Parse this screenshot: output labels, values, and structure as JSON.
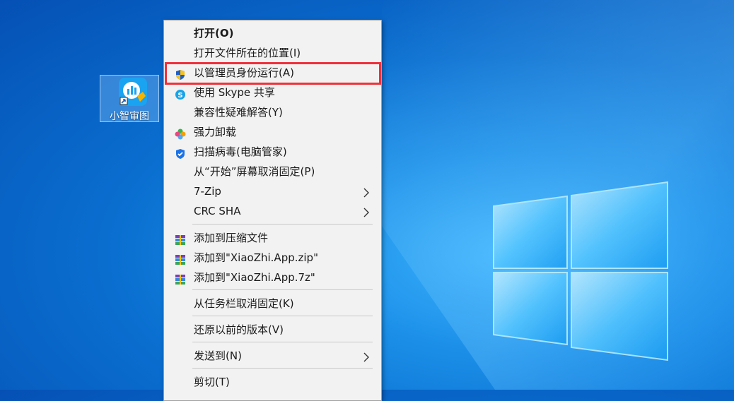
{
  "desktop": {
    "icon_label": "小智审图",
    "icon_name": "app-shortcut-icon"
  },
  "menu": {
    "items": [
      {
        "label": "打开(O)",
        "icon": "",
        "bold": true,
        "submenu": false
      },
      {
        "label": "打开文件所在的位置(I)",
        "icon": "",
        "submenu": false
      },
      {
        "label": "以管理员身份运行(A)",
        "icon": "uac-shield-icon",
        "submenu": false,
        "highlighted": true
      },
      {
        "label": "使用 Skype 共享",
        "icon": "skype-icon",
        "submenu": false
      },
      {
        "label": "兼容性疑难解答(Y)",
        "icon": "",
        "submenu": false
      },
      {
        "label": "强力卸载",
        "icon": "uninstall-flower-icon",
        "submenu": false
      },
      {
        "label": "扫描病毒(电脑管家)",
        "icon": "pc-manager-shield-icon",
        "submenu": false
      },
      {
        "label": "从“开始”屏幕取消固定(P)",
        "icon": "",
        "submenu": false
      },
      {
        "label": "7-Zip",
        "icon": "",
        "submenu": true
      },
      {
        "label": "CRC SHA",
        "icon": "",
        "submenu": true
      },
      {
        "label": "添加到压缩文件",
        "icon": "winrar-archive-icon",
        "submenu": false
      },
      {
        "label": "添加到\"XiaoZhi.App.zip\"",
        "icon": "winrar-archive-icon",
        "submenu": false
      },
      {
        "label": "添加到\"XiaoZhi.App.7z\"",
        "icon": "winrar-archive-icon",
        "submenu": false
      },
      {
        "label": "从任务栏取消固定(K)",
        "icon": "",
        "submenu": false
      },
      {
        "label": "还原以前的版本(V)",
        "icon": "",
        "submenu": false
      },
      {
        "label": "发送到(N)",
        "icon": "",
        "submenu": true
      },
      {
        "label": "剪切(T)",
        "icon": "",
        "submenu": false
      }
    ]
  },
  "colors": {
    "highlight_border": "#f0303a",
    "menu_bg": "#f2f2f2",
    "wallpaper_blue": "#0a6fd0"
  }
}
